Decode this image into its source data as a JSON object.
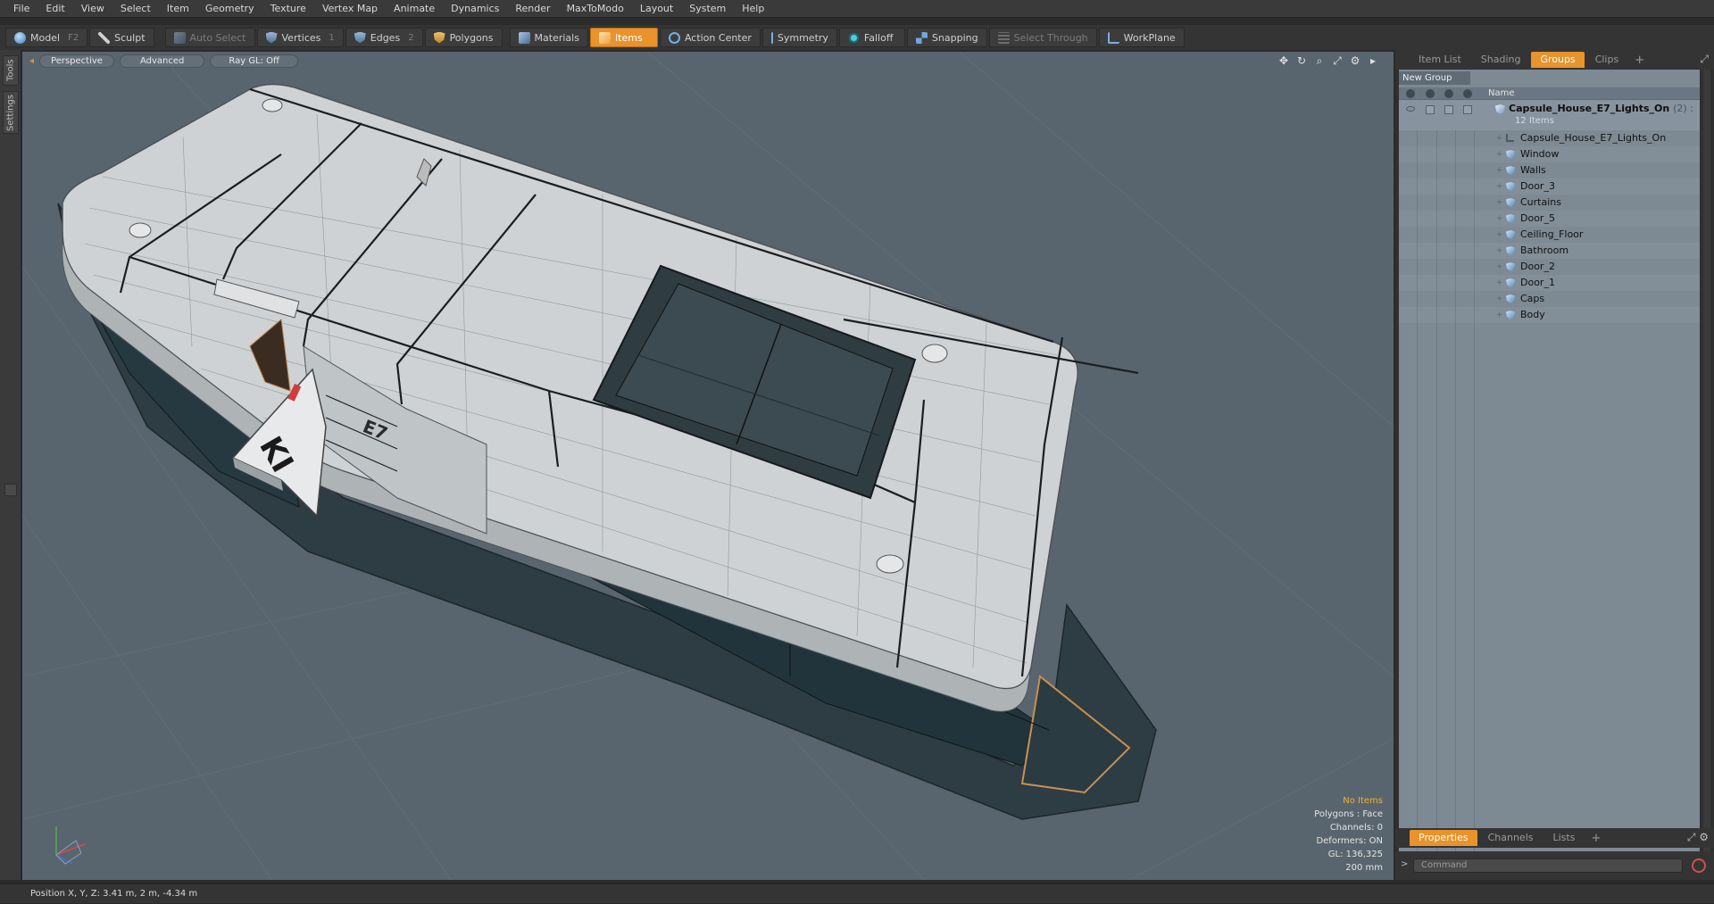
{
  "menu": [
    "File",
    "Edit",
    "View",
    "Select",
    "Item",
    "Geometry",
    "Texture",
    "Vertex Map",
    "Animate",
    "Dynamics",
    "Render",
    "MaxToModo",
    "Layout",
    "System",
    "Help"
  ],
  "toolbar": {
    "model": "Model",
    "model_key": "F2",
    "sculpt": "Sculpt",
    "auto_select": "Auto Select",
    "vertices": "Vertices",
    "vertices_key": "1",
    "edges": "Edges",
    "edges_key": "2",
    "polygons": "Polygons",
    "materials": "Materials",
    "items": "Items",
    "action_center": "Action Center",
    "symmetry": "Symmetry",
    "falloff": "Falloff",
    "snapping": "Snapping",
    "select_through": "Select Through",
    "workplane": "WorkPlane"
  },
  "left_tabs": {
    "tools": "Tools",
    "settings": "Settings"
  },
  "viewport": {
    "view_mode": "Perspective",
    "shading": "Advanced",
    "raygl": "Ray GL: Off",
    "info": {
      "items": "No Items",
      "polygons": "Polygons : Face",
      "channels": "Channels: 0",
      "deformers": "Deformers: ON",
      "gl": "GL: 136,325",
      "scale": "200 mm"
    }
  },
  "scene_text": {
    "door_logo": "KI",
    "side_label": "E7"
  },
  "right_panel": {
    "tabs": [
      "Item List",
      "Shading",
      "Groups",
      "Clips"
    ],
    "active_tab": "Groups",
    "new_group": "New Group",
    "column_name": "Name",
    "group": {
      "name": "Capsule_House_E7_Lights_On",
      "suffix": "(2) :",
      "count": "12 Items"
    },
    "items": [
      "Capsule_House_E7_Lights_On",
      "Window",
      "Walls",
      "Door_3",
      "Curtains",
      "Door_5",
      "Ceiling_Floor",
      "Bathroom",
      "Door_2",
      "Door_1",
      "Caps",
      "Body"
    ],
    "bottom_tabs": [
      "Properties",
      "Channels",
      "Lists"
    ],
    "active_bottom_tab": "Properties",
    "command_placeholder": "Command"
  },
  "status": {
    "position": "Position X, Y, Z:   3.41 m, 2 m, -4.34 m"
  },
  "colors": {
    "accent": "#e8932b",
    "viewport_bg": "#59656e",
    "panel_bg": "#7d8a94"
  }
}
